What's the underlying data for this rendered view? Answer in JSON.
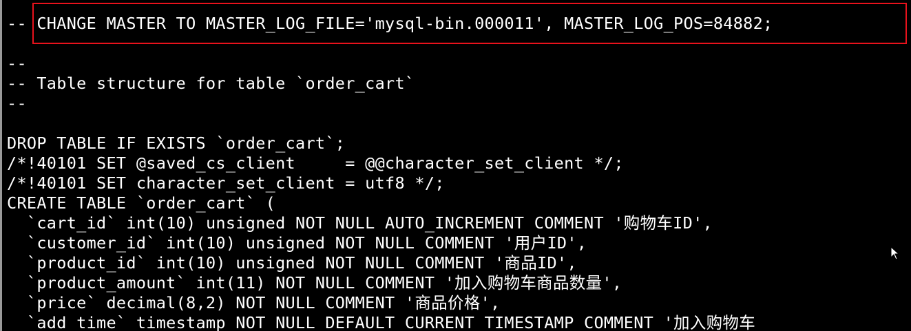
{
  "terminal": {
    "lines": [
      "-- CHANGE MASTER TO MASTER_LOG_FILE='mysql-bin.000011', MASTER_LOG_POS=84882;",
      "--",
      "-- Table structure for table `order_cart`",
      "--",
      "",
      "DROP TABLE IF EXISTS `order_cart`;",
      "/*!40101 SET @saved_cs_client     = @@character_set_client */;",
      "/*!40101 SET character_set_client = utf8 */;",
      "CREATE TABLE `order_cart` (",
      "  `cart_id` int(10) unsigned NOT NULL AUTO_INCREMENT COMMENT '购物车ID',",
      "  `customer_id` int(10) unsigned NOT NULL COMMENT '用户ID',",
      "  `product_id` int(10) unsigned NOT NULL COMMENT '商品ID',",
      "  `product_amount` int(11) NOT NULL COMMENT '加入购物车商品数量',",
      "  `price` decimal(8,2) NOT NULL COMMENT '商品价格',",
      "  `add_time` timestamp NOT NULL DEFAULT CURRENT_TIMESTAMP COMMENT '加入购物车"
    ]
  },
  "colors": {
    "background": "#000000",
    "text": "#ffffff",
    "highlight": "#e8121c"
  },
  "icons": {
    "cursor": "mouse-pointer-icon"
  }
}
